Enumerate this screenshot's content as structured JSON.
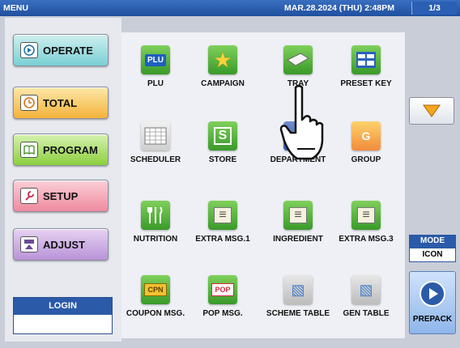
{
  "titlebar": {
    "menu_label": "MENU",
    "datetime": "MAR.28.2024 (THU)  2:48PM",
    "page": "1/3"
  },
  "nav": [
    {
      "label": "OPERATE",
      "icon": "play-circle-icon"
    },
    {
      "label": "TOTAL",
      "icon": "clock-icon"
    },
    {
      "label": "PROGRAM",
      "icon": "book-icon"
    },
    {
      "label": "SETUP",
      "icon": "wrench-icon"
    },
    {
      "label": "ADJUST",
      "icon": "scale-adjust-icon"
    }
  ],
  "login": {
    "label": "LOGIN",
    "value": ""
  },
  "tiles": [
    {
      "label": "PLU",
      "icon": "plu-icon",
      "glyph": "PLU"
    },
    {
      "label": "CAMPAIGN",
      "icon": "star-icon",
      "glyph": "★"
    },
    {
      "label": "TRAY",
      "icon": "tray-icon",
      "glyph": "▭"
    },
    {
      "label": "PRESET KEY",
      "icon": "keyboard-icon",
      "glyph": "▦"
    },
    {
      "label": "SCHEDULER",
      "icon": "calendar-icon",
      "glyph": "▤"
    },
    {
      "label": "STORE",
      "icon": "store-icon",
      "glyph": "S"
    },
    {
      "label": "DEPARTMENT",
      "icon": "department-icon",
      "glyph": "▥"
    },
    {
      "label": "GROUP",
      "icon": "group-icon",
      "glyph": "G"
    },
    {
      "label": "NUTRITION",
      "icon": "cutlery-icon",
      "glyph": "🍴"
    },
    {
      "label": "EXTRA MSG.1",
      "icon": "message-icon",
      "glyph": "≡"
    },
    {
      "label": "INGREDIENT",
      "icon": "message-icon",
      "glyph": "≡"
    },
    {
      "label": "EXTRA MSG.3",
      "icon": "message-icon",
      "glyph": "≡"
    },
    {
      "label": "COUPON MSG.",
      "icon": "coupon-icon",
      "glyph": "CPN"
    },
    {
      "label": "POP MSG.",
      "icon": "pop-icon",
      "glyph": "POP"
    },
    {
      "label": "SCHEME TABLE",
      "icon": "scheme-table-icon",
      "glyph": "▧"
    },
    {
      "label": "GEN TABLE",
      "icon": "gen-table-icon",
      "glyph": "▧"
    }
  ],
  "mode": {
    "label": "MODE",
    "value": "ICON"
  },
  "prepack": {
    "label": "PREPACK"
  }
}
